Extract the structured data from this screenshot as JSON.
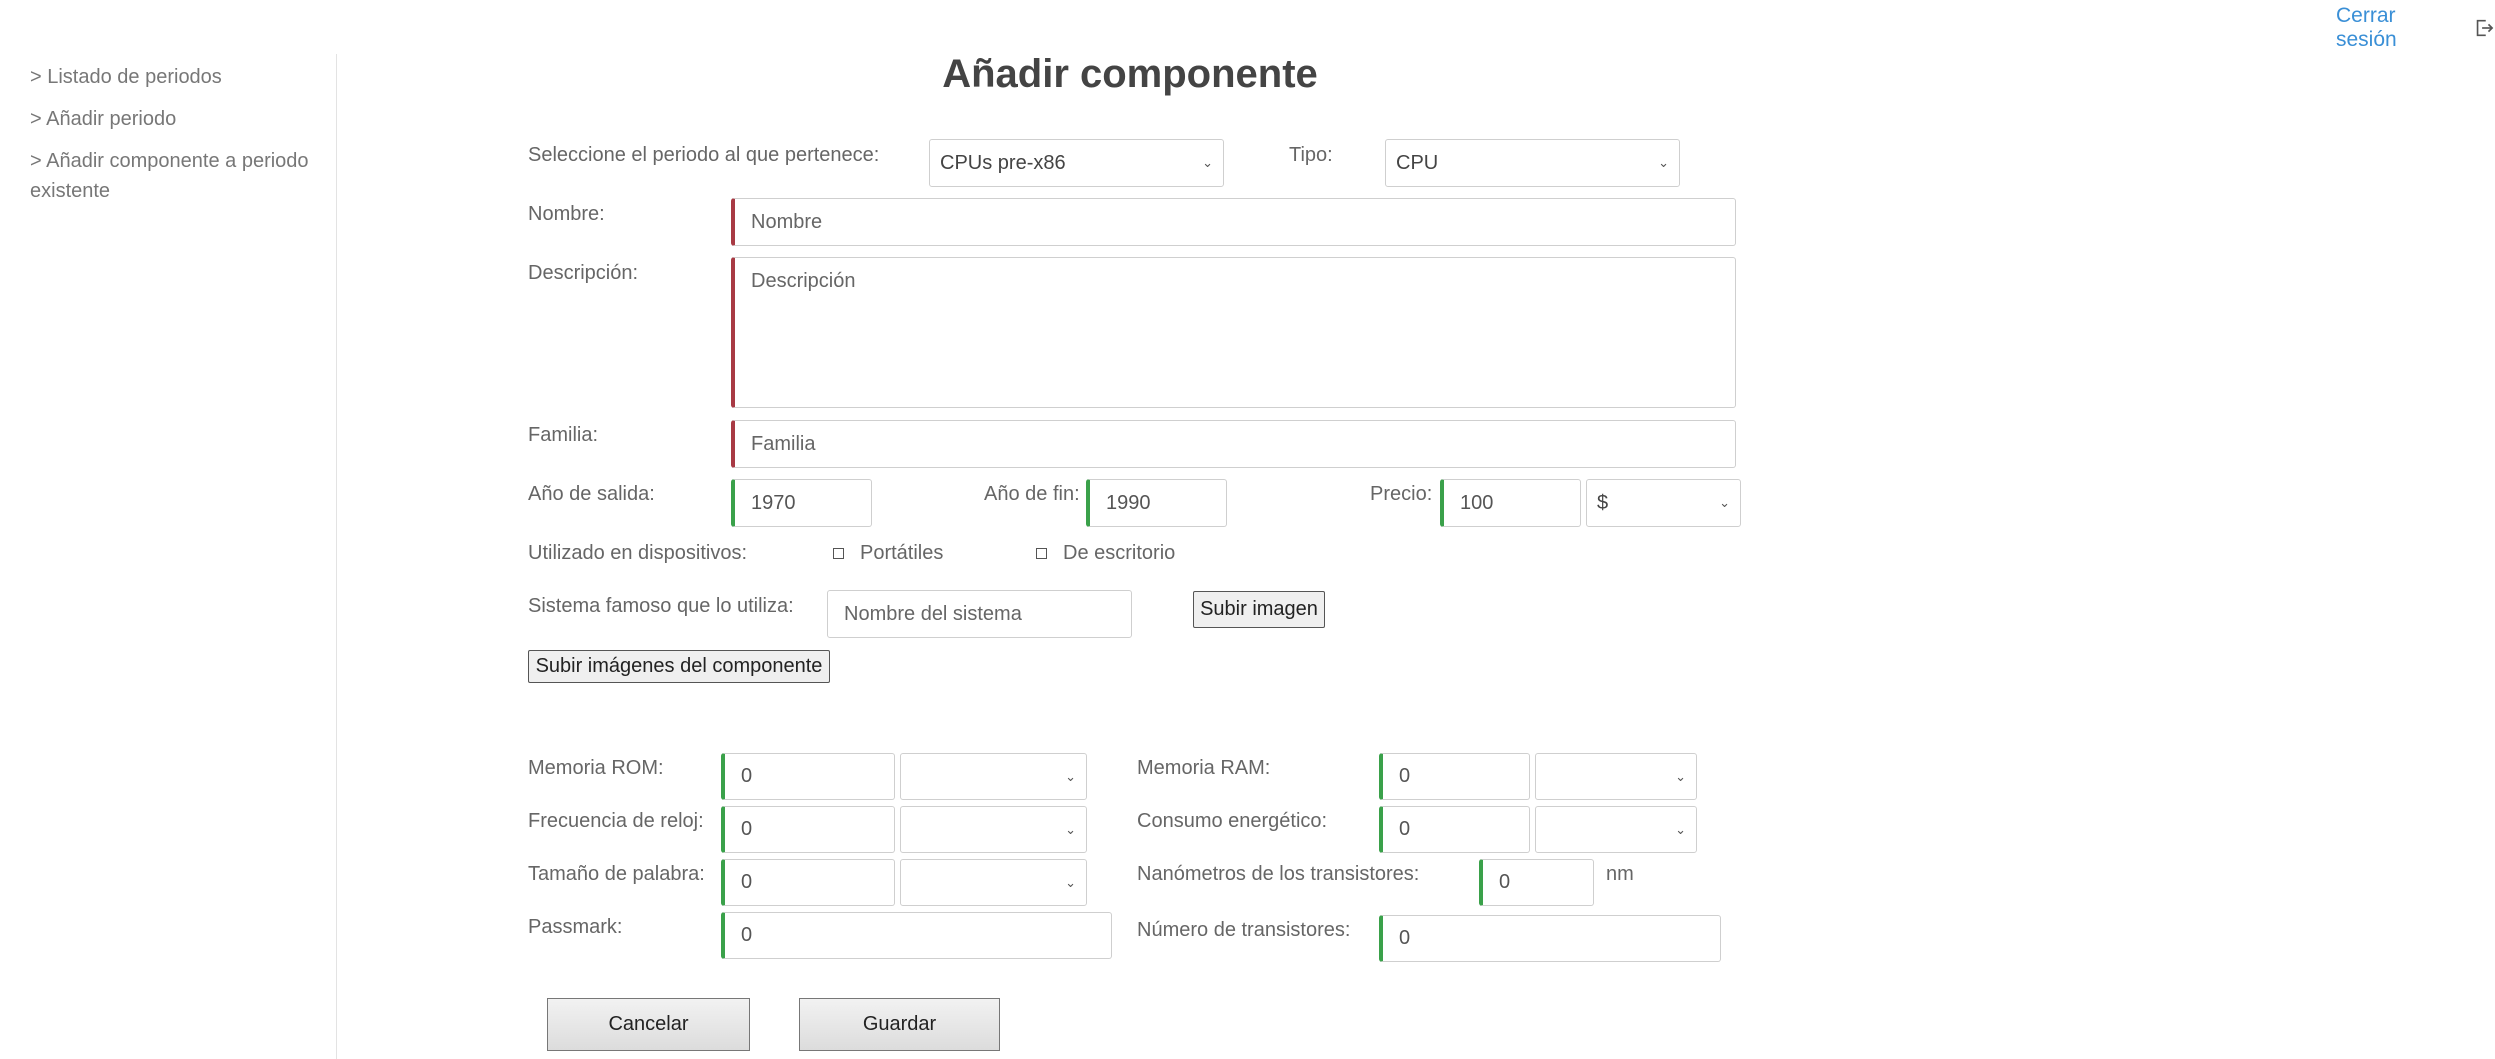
{
  "header": {
    "logout_label": "Cerrar sesión"
  },
  "sidebar": {
    "items": [
      {
        "label": "> Listado de periodos"
      },
      {
        "label": "> Añadir periodo"
      },
      {
        "label": "> Añadir componente a periodo existente"
      }
    ]
  },
  "form": {
    "title": "Añadir componente",
    "periodo": {
      "label": "Seleccione el periodo al que pertenece:",
      "value": "CPUs pre-x86"
    },
    "tipo": {
      "label": "Tipo:",
      "value": "CPU"
    },
    "nombre": {
      "label": "Nombre:",
      "placeholder": "Nombre"
    },
    "descripcion": {
      "label": "Descripción:",
      "placeholder": "Descripción"
    },
    "familia": {
      "label": "Familia:",
      "placeholder": "Familia"
    },
    "anio_salida": {
      "label": "Año de salida:",
      "value": "1970"
    },
    "anio_fin": {
      "label": "Año de fin:",
      "value": "1990"
    },
    "precio": {
      "label": "Precio:",
      "value": "100",
      "currency": "$"
    },
    "dispositivos": {
      "label": "Utilizado en dispositivos:",
      "portatiles": "Portátiles",
      "escritorio": "De escritorio"
    },
    "sistema": {
      "label": "Sistema famoso que lo utiliza:",
      "placeholder": "Nombre del sistema",
      "upload_label": "Subir imagen"
    },
    "upload_images_label": "Subir imágenes del componente",
    "memoria_rom": {
      "label": "Memoria ROM:",
      "value": "0",
      "unit": ""
    },
    "memoria_ram": {
      "label": "Memoria RAM:",
      "value": "0",
      "unit": ""
    },
    "frecuencia": {
      "label": "Frecuencia de reloj:",
      "value": "0",
      "unit": ""
    },
    "consumo": {
      "label": "Consumo energético:",
      "value": "0",
      "unit": ""
    },
    "palabra": {
      "label": "Tamaño de palabra:",
      "value": "0",
      "unit": ""
    },
    "nanometros": {
      "label": "Nanómetros de los transistores:",
      "value": "0",
      "unit": "nm"
    },
    "passmark": {
      "label": "Passmark:",
      "value": "0"
    },
    "num_transistores": {
      "label": "Número de transistores:",
      "value": "0"
    },
    "cancel_label": "Cancelar",
    "save_label": "Guardar"
  },
  "colors": {
    "accent_link": "#3a8fd6",
    "required_border": "#a83a44",
    "filled_border": "#3aa14a"
  }
}
